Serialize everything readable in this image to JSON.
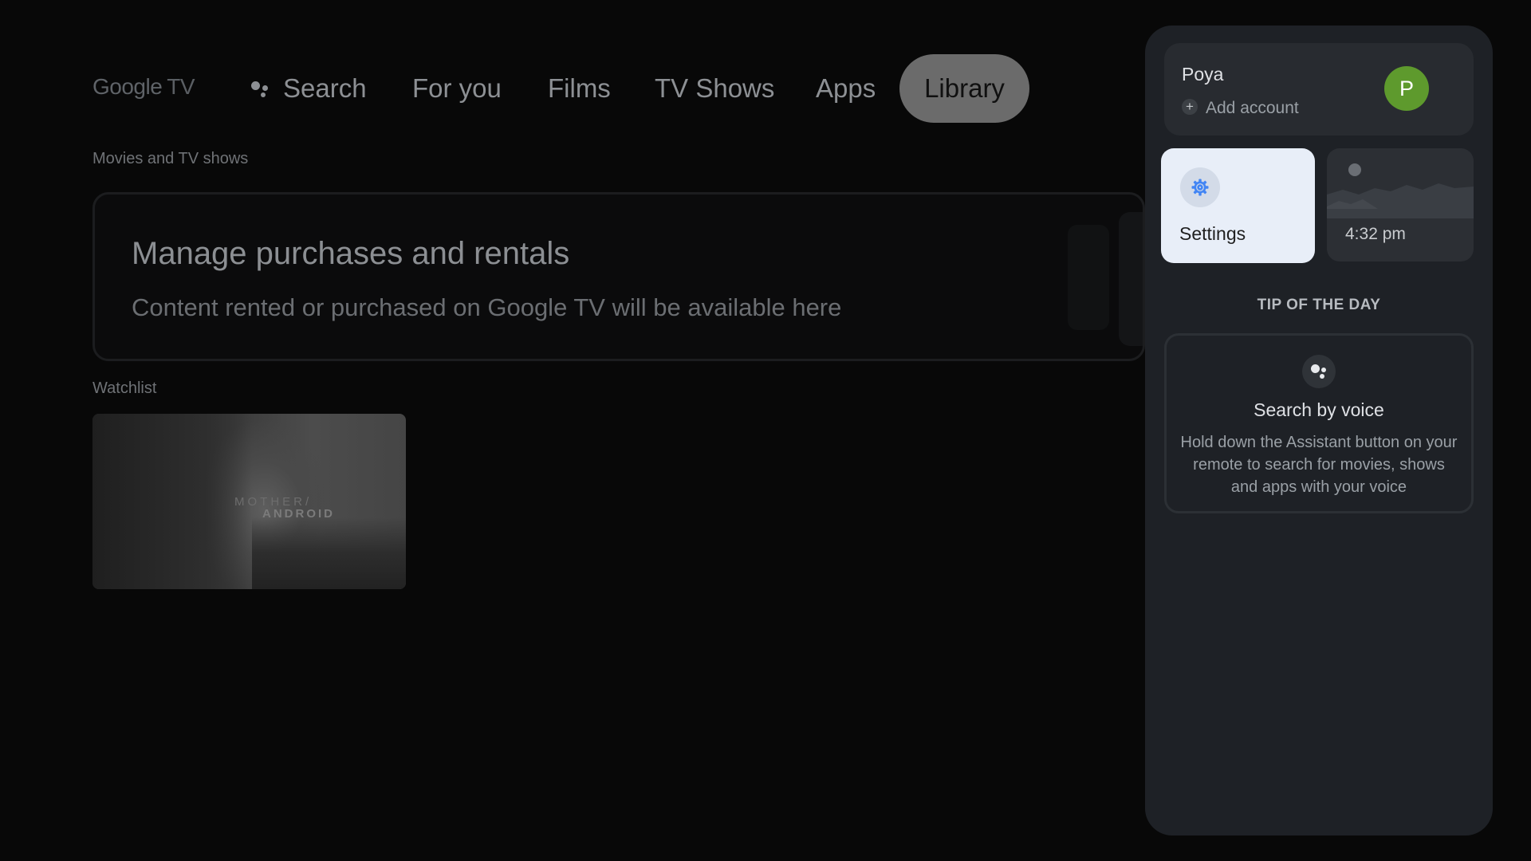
{
  "header": {
    "brand_google": "Google",
    "brand_tv": "TV",
    "nav": {
      "search": "Search",
      "for_you": "For you",
      "films": "Films",
      "tv_shows": "TV Shows",
      "apps": "Apps",
      "library": "Library"
    },
    "active_tab": "Library"
  },
  "library": {
    "movies_section_label": "Movies and TV shows",
    "manage_card": {
      "title": "Manage purchases and rentals",
      "subtitle": "Content rented or purchased on Google TV will be available here"
    },
    "watchlist_label": "Watchlist",
    "watchlist": [
      {
        "title_line1": "MOTHER/",
        "title_line2": "ANDROID"
      }
    ]
  },
  "panel": {
    "account": {
      "name": "Poya",
      "avatar_initial": "P",
      "avatar_color": "#5e9a2d",
      "add_account": "Add account"
    },
    "settings_label": "Settings",
    "clock_time": "4:32 pm",
    "tip": {
      "heading": "TIP OF THE DAY",
      "title": "Search by voice",
      "body": "Hold down the Assistant button on your remote to search for movies, shows and apps with your voice"
    }
  },
  "colors": {
    "background": "#080808",
    "panel": "#1e2126",
    "settings_tile": "#e8eef8",
    "gear": "#4285f4"
  }
}
